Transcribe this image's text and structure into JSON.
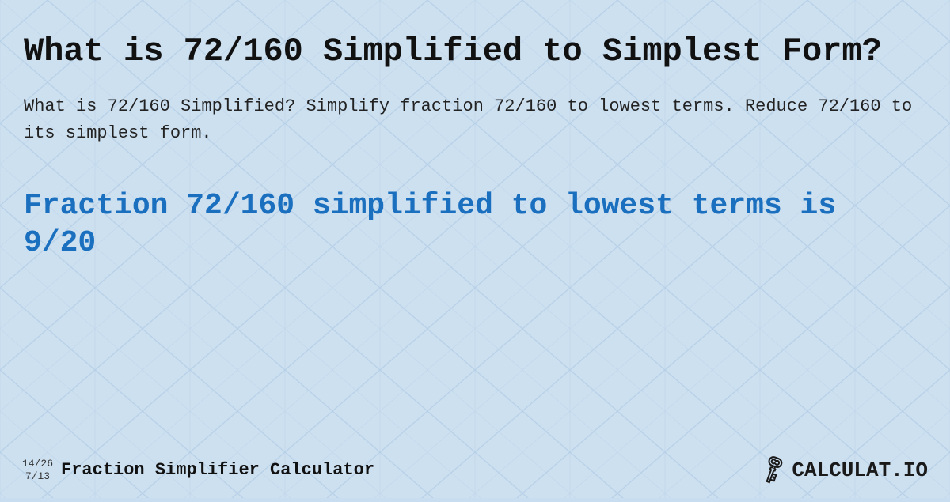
{
  "background": {
    "color": "#cde0f0"
  },
  "main_title": "What is 72/160 Simplified to Simplest Form?",
  "description": "What is 72/160 Simplified? Simplify fraction 72/160 to lowest terms. Reduce 72/160 to its simplest form.",
  "result_text": "Fraction 72/160 simplified to lowest terms is 9/20",
  "footer": {
    "fraction_top": "14/26",
    "fraction_bottom": "7/13",
    "site_title": "Fraction Simplifier Calculator",
    "logo_text": "CALCULAT.IO",
    "logo_icon": "🔑"
  }
}
